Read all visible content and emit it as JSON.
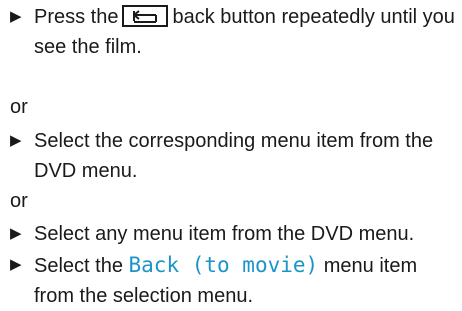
{
  "steps": [
    {
      "pre": "Press the",
      "post": "back button repeatedly until you see the film.",
      "icon": "back-arrow-icon"
    },
    {
      "text": "Select the corresponding menu item from the DVD menu."
    },
    {
      "text": "Select any menu item from the DVD menu."
    },
    {
      "pre": "Select the",
      "highlight": "Back (to movie)",
      "post": "menu item from the selection menu."
    }
  ],
  "or_label": "or",
  "highlight_color": "#1b95c9",
  "bullet_glyph": "▶"
}
